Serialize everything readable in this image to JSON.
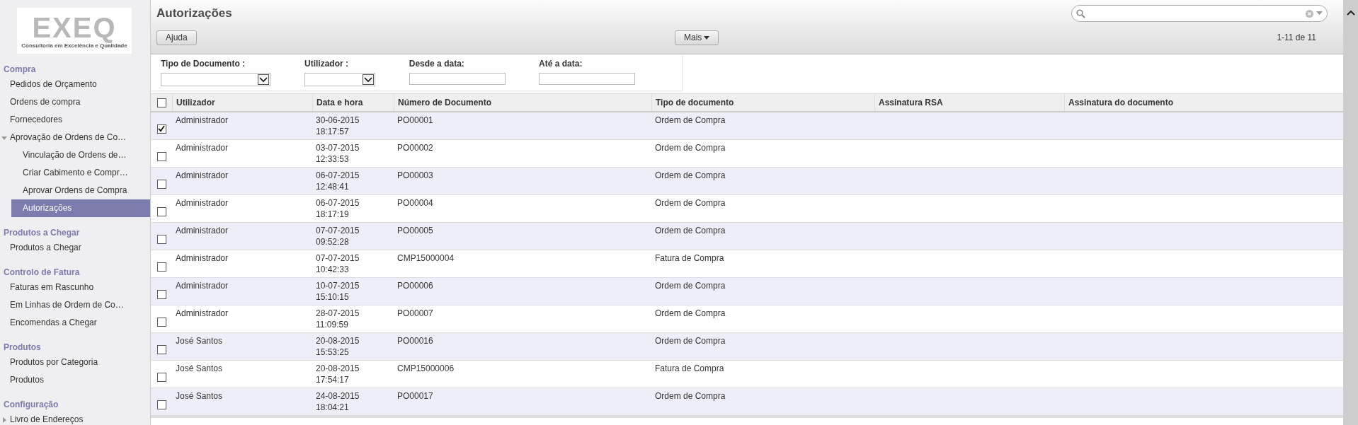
{
  "logo": {
    "wordmark": "EXEQ",
    "tagline": "Consultoria em Excelência e Qualidade"
  },
  "sidebar": {
    "sections": [
      {
        "title": "Compra",
        "items": [
          {
            "kind": "leaf",
            "label": "Pedidos de Orçamento",
            "selected": false
          },
          {
            "kind": "leaf",
            "label": "Ordens de compra",
            "selected": false
          },
          {
            "kind": "leaf",
            "label": "Fornecedores",
            "selected": false
          },
          {
            "kind": "folder",
            "label": "Aprovação de Ordens de Co…",
            "selected": false,
            "expanded": true,
            "children": [
              {
                "kind": "leaf",
                "label": "Vinculação de Ordens de…",
                "selected": false
              },
              {
                "kind": "leaf",
                "label": "Criar Cabimento e Compr…",
                "selected": false
              },
              {
                "kind": "leaf",
                "label": "Aprovar Ordens de Compra",
                "selected": false
              },
              {
                "kind": "leaf",
                "label": "Autorizações",
                "selected": true
              }
            ]
          }
        ]
      },
      {
        "title": "Produtos a Chegar",
        "items": [
          {
            "kind": "leaf",
            "label": "Produtos a Chegar",
            "selected": false
          }
        ]
      },
      {
        "title": "Controlo de Fatura",
        "items": [
          {
            "kind": "leaf",
            "label": "Faturas em Rascunho",
            "selected": false
          },
          {
            "kind": "leaf",
            "label": "Em Linhas de Ordem de Co…",
            "selected": false
          },
          {
            "kind": "leaf",
            "label": "Encomendas a Chegar",
            "selected": false
          }
        ]
      },
      {
        "title": "Produtos",
        "items": [
          {
            "kind": "leaf",
            "label": "Produtos por Categoria",
            "selected": false
          },
          {
            "kind": "leaf",
            "label": "Produtos",
            "selected": false
          }
        ]
      },
      {
        "title": "Configuração",
        "items": [
          {
            "kind": "folder",
            "label": "Livro de Endereços",
            "selected": false,
            "expanded": false
          }
        ]
      }
    ]
  },
  "header": {
    "title": "Autorizações",
    "help_button": "Ajuda",
    "more_button": "Mais",
    "pager": "1-11 de 11"
  },
  "filters": [
    {
      "kind": "select",
      "label": "Tipo de Documento :"
    },
    {
      "kind": "select",
      "label": "Utilizador :"
    },
    {
      "kind": "date",
      "label": "Desde a data:"
    },
    {
      "kind": "date",
      "label": "Até a data:"
    }
  ],
  "table": {
    "all_checked": false,
    "columns": [
      "Utilizador",
      "Data e hora",
      "Número de Documento",
      "Tipo de documento",
      "Assinatura RSA",
      "Assinatura do documento"
    ],
    "rows": [
      {
        "checked": true,
        "cells": [
          "Administrador",
          "30-06-2015\n18:17:57",
          "PO00001",
          "Ordem de Compra",
          "",
          ""
        ]
      },
      {
        "checked": false,
        "cells": [
          "Administrador",
          "03-07-2015\n12:33:53",
          "PO00002",
          "Ordem de Compra",
          "",
          ""
        ]
      },
      {
        "checked": false,
        "cells": [
          "Administrador",
          "06-07-2015\n12:48:41",
          "PO00003",
          "Ordem de Compra",
          "",
          ""
        ]
      },
      {
        "checked": false,
        "cells": [
          "Administrador",
          "06-07-2015\n18:17:19",
          "PO00004",
          "Ordem de Compra",
          "",
          ""
        ]
      },
      {
        "checked": false,
        "cells": [
          "Administrador",
          "07-07-2015\n09:52:28",
          "PO00005",
          "Ordem de Compra",
          "",
          ""
        ]
      },
      {
        "checked": false,
        "cells": [
          "Administrador",
          "07-07-2015\n10:42:33",
          "CMP15000004",
          "Fatura de Compra",
          "",
          ""
        ]
      },
      {
        "checked": false,
        "cells": [
          "Administrador",
          "10-07-2015\n15:10:15",
          "PO00006",
          "Ordem de Compra",
          "",
          ""
        ]
      },
      {
        "checked": false,
        "cells": [
          "Administrador",
          "28-07-2015\n11:09:59",
          "PO00007",
          "Ordem de Compra",
          "",
          ""
        ]
      },
      {
        "checked": false,
        "cells": [
          "José Santos",
          "20-08-2015\n15:53:25",
          "PO00016",
          "Ordem de Compra",
          "",
          ""
        ]
      },
      {
        "checked": false,
        "cells": [
          "José Santos",
          "20-08-2015\n17:54:17",
          "CMP15000006",
          "Fatura de Compra",
          "",
          ""
        ]
      },
      {
        "checked": false,
        "cells": [
          "José Santos",
          "24-08-2015\n18:04:21",
          "PO00017",
          "Ordem de Compra",
          "",
          ""
        ]
      }
    ]
  }
}
